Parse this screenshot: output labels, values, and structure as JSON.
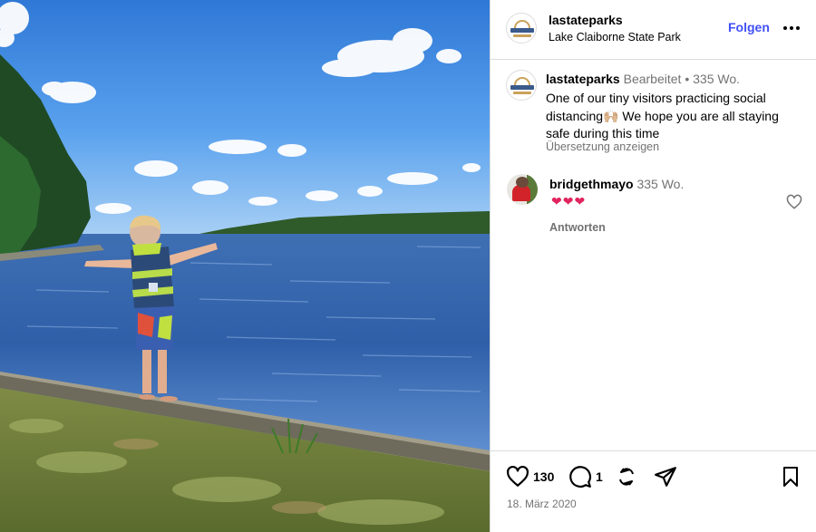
{
  "post": {
    "image_alt": "Kleines Kind mit Schwimmweste steht am Seeufer mit ausgestreckten Armen"
  },
  "header": {
    "username": "lastateparks",
    "location": "Lake Claiborne State Park",
    "follow_label": "Folgen",
    "more_icon": "more-horizontal-icon"
  },
  "caption": {
    "username": "lastateparks",
    "edited": "Bearbeitet",
    "separator": "•",
    "age": "335 Wo.",
    "text": "One of our tiny visitors practicing social distancing🙌🏼 We hope you are all staying safe during this time",
    "translate_label": "Übersetzung anzeigen"
  },
  "comment": {
    "username": "bridgethmayo",
    "age": "335 Wo.",
    "text": "❤❤❤",
    "reply_label": "Antworten"
  },
  "actions": {
    "like_count": "130",
    "comment_count": "1",
    "date": "18. März 2020"
  }
}
